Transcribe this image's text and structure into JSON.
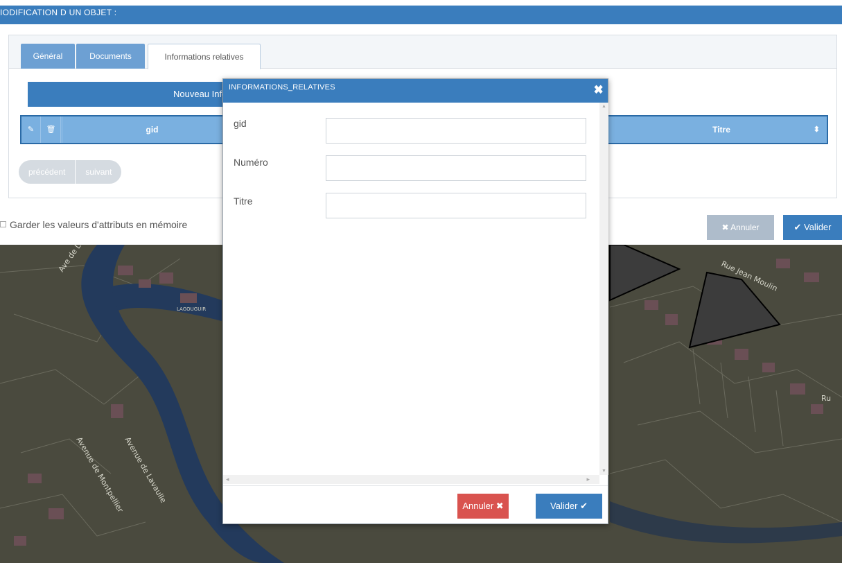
{
  "header": {
    "title": "IODIFICATION D UN OBJET :"
  },
  "tabs": [
    {
      "label": "Général"
    },
    {
      "label": "Documents"
    },
    {
      "label": "Informations relatives"
    }
  ],
  "panel": {
    "new_button_label": "Nouveau Inforr",
    "table": {
      "edit_icon": "✎",
      "delete_icon": "🗑",
      "columns": {
        "gid": "gid",
        "titre": "Titre"
      },
      "sort_icon": "⬍"
    },
    "pager": {
      "prev": "précédent",
      "next": "suivant"
    }
  },
  "keep_values_label": "Garder les valeurs d'attributs en mémoire",
  "main_buttons": {
    "annuler": "✖ Annuler",
    "valider": "✔ Valider"
  },
  "map": {
    "labels": {
      "street1": "Rue Jean Moulin",
      "street2": "Avenue de Montpellier",
      "street3": "Avenue de Lavaulle",
      "street4": "Ave de Lo",
      "place": "LAGOUGUIR",
      "edge": "Ru"
    }
  },
  "modal": {
    "title": "INFORMATIONS_RELATIVES",
    "close_icon": "✖",
    "fields": [
      {
        "label": "gid",
        "value": ""
      },
      {
        "label": "Numéro",
        "value": ""
      },
      {
        "label": "Titre",
        "value": ""
      }
    ],
    "buttons": {
      "annuler": "Annuler ✖",
      "valider": "Valider ✔"
    }
  }
}
